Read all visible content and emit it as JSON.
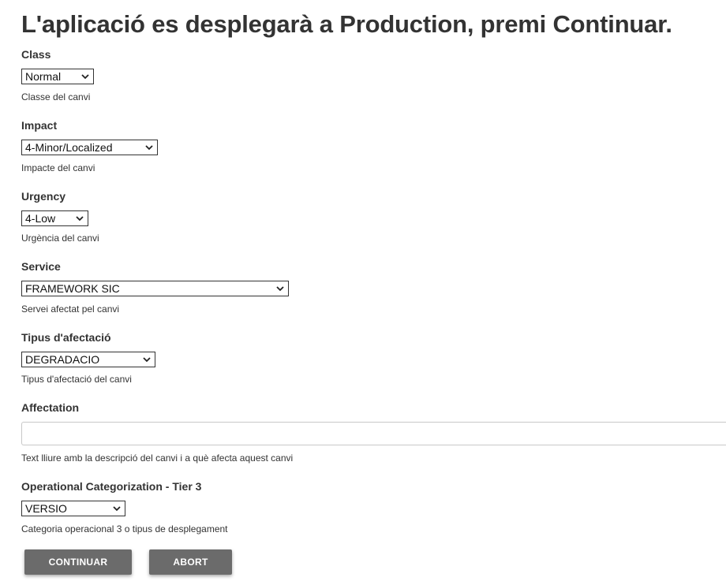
{
  "page": {
    "title": "L'aplicació es desplegarà a Production, premi Continuar."
  },
  "form": {
    "class": {
      "label": "Class",
      "value": "Normal",
      "help": "Classe del canvi"
    },
    "impact": {
      "label": "Impact",
      "value": "4-Minor/Localized",
      "help": "Impacte del canvi"
    },
    "urgency": {
      "label": "Urgency",
      "value": "4-Low",
      "help": "Urgència del canvi"
    },
    "service": {
      "label": "Service",
      "value": "FRAMEWORK SIC",
      "help": "Servei afectat pel canvi"
    },
    "tipus_afectacio": {
      "label": "Tipus d'afectació",
      "value": "DEGRADACIO",
      "help": "Tipus d'afectació del canvi"
    },
    "affectation": {
      "label": "Affectation",
      "value": "",
      "help": "Text lliure amb la descripció del canvi i a què afecta aquest canvi"
    },
    "tier3": {
      "label": "Operational Categorization - Tier 3",
      "value": "VERSIO",
      "help": "Categoria operacional 3 o tipus de desplegament"
    }
  },
  "actions": {
    "continue_label": "CONTINUAR",
    "abort_label": "ABORT"
  },
  "icons": {
    "select_arrow": "chevron-down-icon"
  },
  "colors": {
    "text": "#333333",
    "button_bg": "#6b6b6b",
    "button_text": "#ffffff"
  }
}
